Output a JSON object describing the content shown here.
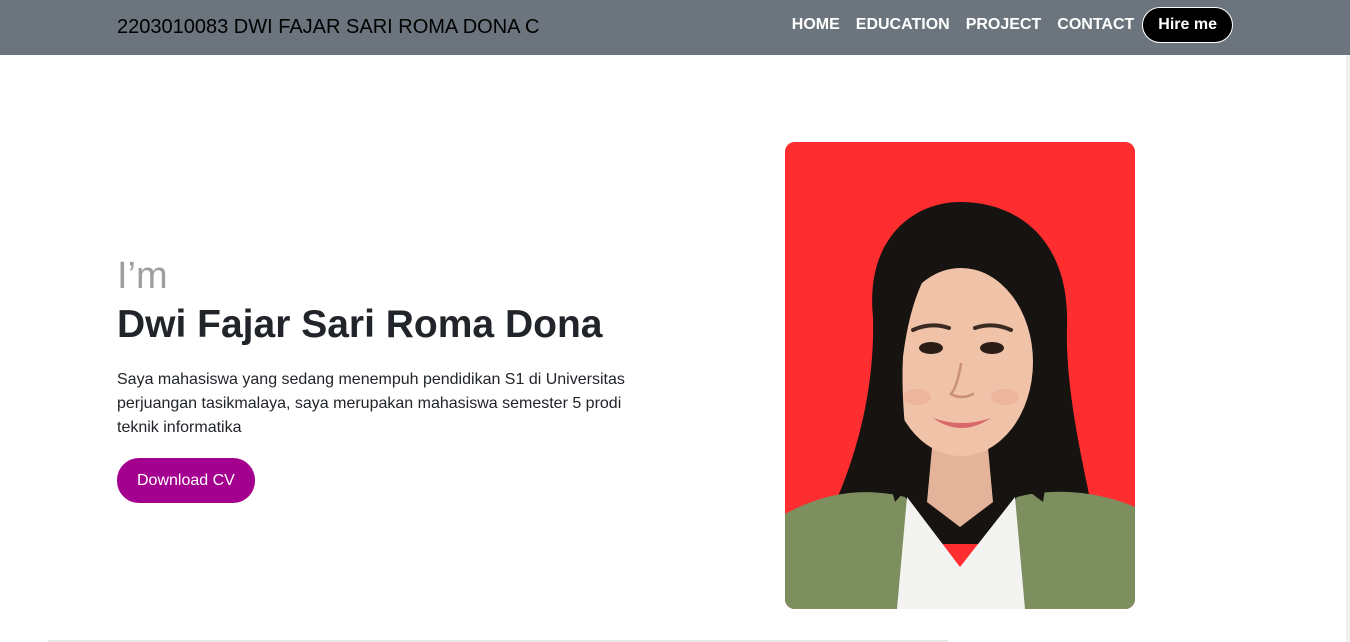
{
  "navbar": {
    "brand": "2203010083 DWI FAJAR SARI ROMA DONA C",
    "links": [
      {
        "label": "HOME"
      },
      {
        "label": "EDUCATION"
      },
      {
        "label": "PROJECT"
      },
      {
        "label": "CONTACT"
      }
    ],
    "hire_label": "Hire me"
  },
  "hero": {
    "intro": "I’m",
    "name": "Dwi Fajar Sari Roma Dona",
    "description": "Saya mahasiswa yang sedang menempuh pendidikan S1 di Universitas perjuangan tasikmalaya, saya merupakan mahasiswa semester 5 prodi teknik informatika",
    "cta_label": "Download CV"
  },
  "colors": {
    "navbar_bg": "#6c757d",
    "cta_bg": "#a4008f",
    "hire_bg": "#000000",
    "photo_bg": "#fe2d2f"
  }
}
